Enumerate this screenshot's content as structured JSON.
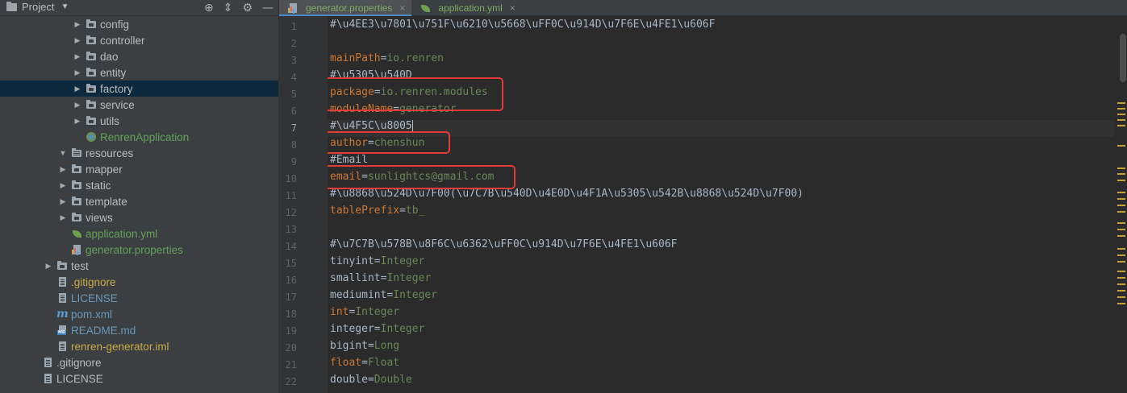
{
  "project_panel": {
    "title": "Project",
    "tree": [
      {
        "label": "config",
        "indent": 3,
        "arrow": "right",
        "icon": "folder",
        "color": "default"
      },
      {
        "label": "controller",
        "indent": 3,
        "arrow": "right",
        "icon": "folder",
        "color": "default"
      },
      {
        "label": "dao",
        "indent": 3,
        "arrow": "right",
        "icon": "folder",
        "color": "default"
      },
      {
        "label": "entity",
        "indent": 3,
        "arrow": "right",
        "icon": "folder",
        "color": "default"
      },
      {
        "label": "factory",
        "indent": 3,
        "arrow": "right",
        "icon": "folder",
        "color": "default",
        "selected": true
      },
      {
        "label": "service",
        "indent": 3,
        "arrow": "right",
        "icon": "folder",
        "color": "default"
      },
      {
        "label": "utils",
        "indent": 3,
        "arrow": "right",
        "icon": "folder",
        "color": "default"
      },
      {
        "label": "RenrenApplication",
        "indent": 3,
        "arrow": "none",
        "icon": "spring",
        "color": "green"
      },
      {
        "label": "resources",
        "indent": 2,
        "arrow": "down",
        "icon": "resfolder",
        "color": "default"
      },
      {
        "label": "mapper",
        "indent": 3,
        "arrow": "right",
        "icon": "folder",
        "color": "default",
        "shift": -1
      },
      {
        "label": "static",
        "indent": 3,
        "arrow": "right",
        "icon": "folder",
        "color": "default",
        "shift": -1
      },
      {
        "label": "template",
        "indent": 3,
        "arrow": "right",
        "icon": "folder",
        "color": "default",
        "shift": -1
      },
      {
        "label": "views",
        "indent": 3,
        "arrow": "right",
        "icon": "folder",
        "color": "default",
        "shift": -1
      },
      {
        "label": "application.yml",
        "indent": 3,
        "arrow": "none",
        "icon": "leaf",
        "color": "green",
        "shift": -1
      },
      {
        "label": "generator.properties",
        "indent": 3,
        "arrow": "none",
        "icon": "props",
        "color": "green",
        "shift": -1
      },
      {
        "label": "test",
        "indent": 1,
        "arrow": "right",
        "icon": "folder",
        "color": "default"
      },
      {
        "label": ".gitignore",
        "indent": 1,
        "arrow": "none",
        "icon": "file",
        "color": "yellow"
      },
      {
        "label": "LICENSE",
        "indent": 1,
        "arrow": "none",
        "icon": "file",
        "color": "blue"
      },
      {
        "label": "pom.xml",
        "indent": 1,
        "arrow": "none",
        "icon": "maven",
        "color": "blue"
      },
      {
        "label": "README.md",
        "indent": 1,
        "arrow": "none",
        "icon": "md",
        "color": "blue"
      },
      {
        "label": "renren-generator.iml",
        "indent": 1,
        "arrow": "none",
        "icon": "file",
        "color": "yellow"
      },
      {
        "label": ".gitignore",
        "indent": 0,
        "arrow": "none",
        "icon": "file",
        "color": "default"
      },
      {
        "label": "LICENSE",
        "indent": 0,
        "arrow": "none",
        "icon": "file",
        "color": "default"
      }
    ]
  },
  "editor": {
    "tabs": [
      {
        "label": "generator.properties",
        "icon": "props",
        "active": true
      },
      {
        "label": "application.yml",
        "icon": "leaf",
        "active": false
      }
    ],
    "current_line": 7,
    "lines": [
      {
        "n": "1",
        "segs": [
          {
            "t": "#\\u4EE3\\u7801\\u751F\\u6210\\u5668\\uFF0C\\u914D\\u7F6E\\u4FE1\\u606F",
            "c": "default"
          }
        ]
      },
      {
        "n": "2",
        "segs": []
      },
      {
        "n": "3",
        "segs": [
          {
            "t": "mainPath",
            "c": "key"
          },
          {
            "t": "=",
            "c": "eq"
          },
          {
            "t": "io.renren",
            "c": "val"
          }
        ]
      },
      {
        "n": "4",
        "segs": [
          {
            "t": "#\\u5305\\u540D",
            "c": "default"
          }
        ]
      },
      {
        "n": "5",
        "segs": [
          {
            "t": "package",
            "c": "key"
          },
          {
            "t": "=",
            "c": "eq"
          },
          {
            "t": "io.renren.modules",
            "c": "val"
          }
        ]
      },
      {
        "n": "6",
        "segs": [
          {
            "t": "moduleName",
            "c": "key"
          },
          {
            "t": "=",
            "c": "eq"
          },
          {
            "t": "generator",
            "c": "val"
          }
        ]
      },
      {
        "n": "7",
        "segs": [
          {
            "t": "#\\u4F5C\\u8005",
            "c": "default"
          }
        ],
        "caret": true
      },
      {
        "n": "8",
        "segs": [
          {
            "t": "author",
            "c": "key"
          },
          {
            "t": "=",
            "c": "eq"
          },
          {
            "t": "chenshun",
            "c": "val"
          }
        ]
      },
      {
        "n": "9",
        "segs": [
          {
            "t": "#Email",
            "c": "default"
          }
        ]
      },
      {
        "n": "10",
        "segs": [
          {
            "t": "email",
            "c": "key"
          },
          {
            "t": "=",
            "c": "eq"
          },
          {
            "t": "sunlightcs@gmail.com",
            "c": "val"
          }
        ]
      },
      {
        "n": "11",
        "segs": [
          {
            "t": "#\\u8868\\u524D\\u7F00(\\u7C7B\\u540D\\u4E0D\\u4F1A\\u5305\\u542B\\u8868\\u524D\\u7F00)",
            "c": "default"
          }
        ]
      },
      {
        "n": "12",
        "segs": [
          {
            "t": "tablePrefix",
            "c": "key"
          },
          {
            "t": "=",
            "c": "eq"
          },
          {
            "t": "tb_",
            "c": "val"
          }
        ]
      },
      {
        "n": "13",
        "segs": []
      },
      {
        "n": "14",
        "segs": [
          {
            "t": "#\\u7C7B\\u578B\\u8F6C\\u6362\\uFF0C\\u914D\\u7F6E\\u4FE1\\u606F",
            "c": "default"
          }
        ]
      },
      {
        "n": "15",
        "segs": [
          {
            "t": "tinyint",
            "c": "default"
          },
          {
            "t": "=",
            "c": "eq"
          },
          {
            "t": "Integer",
            "c": "val"
          }
        ]
      },
      {
        "n": "16",
        "segs": [
          {
            "t": "smallint",
            "c": "default"
          },
          {
            "t": "=",
            "c": "eq"
          },
          {
            "t": "Integer",
            "c": "val"
          }
        ]
      },
      {
        "n": "17",
        "segs": [
          {
            "t": "mediumint",
            "c": "default"
          },
          {
            "t": "=",
            "c": "eq"
          },
          {
            "t": "Integer",
            "c": "val"
          }
        ]
      },
      {
        "n": "18",
        "segs": [
          {
            "t": "int",
            "c": "key"
          },
          {
            "t": "=",
            "c": "eq"
          },
          {
            "t": "Integer",
            "c": "val"
          }
        ]
      },
      {
        "n": "19",
        "segs": [
          {
            "t": "integer",
            "c": "default"
          },
          {
            "t": "=",
            "c": "eq"
          },
          {
            "t": "Integer",
            "c": "val"
          }
        ]
      },
      {
        "n": "20",
        "segs": [
          {
            "t": "bigint",
            "c": "default"
          },
          {
            "t": "=",
            "c": "eq"
          },
          {
            "t": "Long",
            "c": "val"
          }
        ]
      },
      {
        "n": "21",
        "segs": [
          {
            "t": "float",
            "c": "key"
          },
          {
            "t": "=",
            "c": "eq"
          },
          {
            "t": "Float",
            "c": "val"
          }
        ]
      },
      {
        "n": "22",
        "segs": [
          {
            "t": "double",
            "c": "default"
          },
          {
            "t": "=",
            "c": "eq"
          },
          {
            "t": "Double",
            "c": "val"
          }
        ]
      }
    ]
  },
  "colors": {
    "key": "#cc7832",
    "value": "#6a8759",
    "comment": "#808080",
    "highlight_box": "#e23b3b",
    "selection": "#0d293e"
  }
}
